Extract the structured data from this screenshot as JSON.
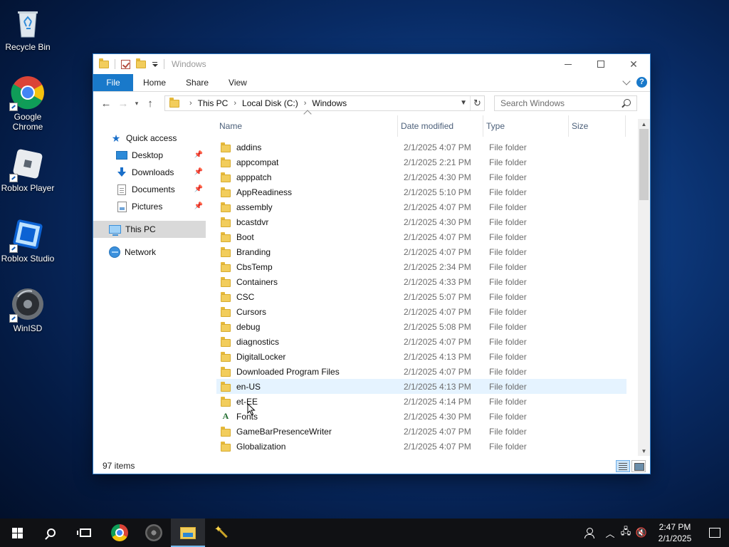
{
  "desktop": {
    "icons": [
      {
        "label": "Recycle Bin",
        "icon": "recycle-bin-icon"
      },
      {
        "label": "Google Chrome",
        "icon": "chrome-icon"
      },
      {
        "label": "Roblox Player",
        "icon": "roblox-player-icon"
      },
      {
        "label": "Roblox Studio",
        "icon": "roblox-studio-icon"
      },
      {
        "label": "WinISD",
        "icon": "speaker-icon"
      }
    ]
  },
  "window": {
    "title": "Windows",
    "controls": {
      "minimize": "—",
      "maximize": "☐",
      "close": "✕"
    },
    "ribbon": {
      "file": "File",
      "home": "Home",
      "share": "Share",
      "view": "View",
      "help": "?"
    },
    "address": {
      "crumbs": [
        "This PC",
        "Local Disk (C:)",
        "Windows"
      ]
    },
    "search": {
      "placeholder": "Search Windows"
    },
    "nav": {
      "quick_access": "Quick access",
      "desktop": "Desktop",
      "downloads": "Downloads",
      "documents": "Documents",
      "pictures": "Pictures",
      "this_pc": "This PC",
      "network": "Network"
    },
    "columns": {
      "name": "Name",
      "date": "Date modified",
      "type": "Type",
      "size": "Size"
    },
    "files": [
      {
        "name": "addins",
        "date": "2/1/2025 4:07 PM",
        "type": "File folder"
      },
      {
        "name": "appcompat",
        "date": "2/1/2025 2:21 PM",
        "type": "File folder"
      },
      {
        "name": "apppatch",
        "date": "2/1/2025 4:30 PM",
        "type": "File folder"
      },
      {
        "name": "AppReadiness",
        "date": "2/1/2025 5:10 PM",
        "type": "File folder"
      },
      {
        "name": "assembly",
        "date": "2/1/2025 4:07 PM",
        "type": "File folder"
      },
      {
        "name": "bcastdvr",
        "date": "2/1/2025 4:30 PM",
        "type": "File folder"
      },
      {
        "name": "Boot",
        "date": "2/1/2025 4:07 PM",
        "type": "File folder"
      },
      {
        "name": "Branding",
        "date": "2/1/2025 4:07 PM",
        "type": "File folder"
      },
      {
        "name": "CbsTemp",
        "date": "2/1/2025 2:34 PM",
        "type": "File folder"
      },
      {
        "name": "Containers",
        "date": "2/1/2025 4:33 PM",
        "type": "File folder"
      },
      {
        "name": "CSC",
        "date": "2/1/2025 5:07 PM",
        "type": "File folder"
      },
      {
        "name": "Cursors",
        "date": "2/1/2025 4:07 PM",
        "type": "File folder"
      },
      {
        "name": "debug",
        "date": "2/1/2025 5:08 PM",
        "type": "File folder"
      },
      {
        "name": "diagnostics",
        "date": "2/1/2025 4:07 PM",
        "type": "File folder"
      },
      {
        "name": "DigitalLocker",
        "date": "2/1/2025 4:13 PM",
        "type": "File folder"
      },
      {
        "name": "Downloaded Program Files",
        "date": "2/1/2025 4:07 PM",
        "type": "File folder"
      },
      {
        "name": "en-US",
        "date": "2/1/2025 4:13 PM",
        "type": "File folder"
      },
      {
        "name": "et-EE",
        "date": "2/1/2025 4:14 PM",
        "type": "File folder"
      },
      {
        "name": "Fonts",
        "date": "2/1/2025 4:30 PM",
        "type": "File folder"
      },
      {
        "name": "GameBarPresenceWriter",
        "date": "2/1/2025 4:07 PM",
        "type": "File folder"
      },
      {
        "name": "Globalization",
        "date": "2/1/2025 4:07 PM",
        "type": "File folder"
      }
    ],
    "status": {
      "items": "97 items"
    }
  },
  "taskbar": {
    "clock_time": "2:47 PM",
    "clock_date": "2/1/2025"
  }
}
